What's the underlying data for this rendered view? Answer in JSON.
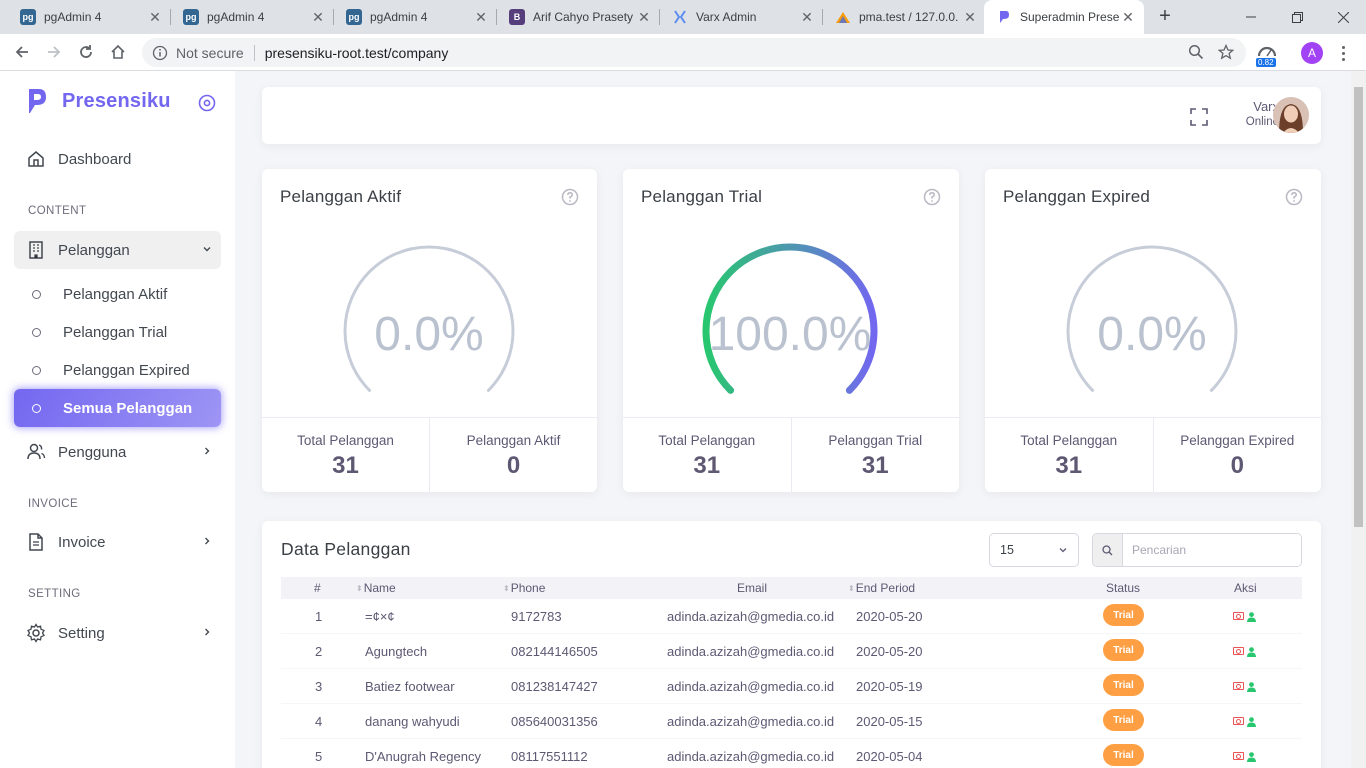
{
  "browser": {
    "tabs": [
      {
        "title": "pgAdmin 4",
        "favicon": "pgadmin-icon"
      },
      {
        "title": "pgAdmin 4",
        "favicon": "pgadmin-icon"
      },
      {
        "title": "pgAdmin 4",
        "favicon": "pgadmin-icon"
      },
      {
        "title": "Arif Cahyo Prasety",
        "favicon": "bootstrap-icon"
      },
      {
        "title": "Varx Admin",
        "favicon": "varx-icon"
      },
      {
        "title": "pma.test / 127.0.0.",
        "favicon": "phpmyadmin-icon"
      },
      {
        "title": "Superadmin Prese",
        "favicon": "presensiku-icon"
      }
    ],
    "active_tab": 6,
    "security_label": "Not secure",
    "url": "presensiku-root.test/company",
    "extension_badge": "0.82",
    "profile_initial": "A"
  },
  "sidebar": {
    "brand": "Presensiku",
    "dashboard": "Dashboard",
    "sections": {
      "content": "CONTENT",
      "invoice": "INVOICE",
      "setting": "SETTING"
    },
    "pelanggan": "Pelanggan",
    "sub_items": [
      "Pelanggan Aktif",
      "Pelanggan Trial",
      "Pelanggan Expired",
      "Semua Pelanggan"
    ],
    "pengguna": "Pengguna",
    "invoice": "Invoice",
    "setting": "Setting"
  },
  "header": {
    "user_name": "Varx",
    "user_status": "Online"
  },
  "stats": [
    {
      "title": "Pelanggan Aktif",
      "percent_label": "0.0%",
      "percent": 0,
      "left_label": "Total Pelanggan",
      "left_value": "31",
      "right_label": "Pelanggan Aktif",
      "right_value": "0"
    },
    {
      "title": "Pelanggan Trial",
      "percent_label": "100.0%",
      "percent": 100,
      "left_label": "Total Pelanggan",
      "left_value": "31",
      "right_label": "Pelanggan Trial",
      "right_value": "31"
    },
    {
      "title": "Pelanggan Expired",
      "percent_label": "0.0%",
      "percent": 0,
      "left_label": "Total Pelanggan",
      "left_value": "31",
      "right_label": "Pelanggan Expired",
      "right_value": "0"
    }
  ],
  "colors": {
    "accent": "#7367f0",
    "gauge_start": "#28c76f",
    "gauge_end": "#7367f0",
    "trial_badge": "#ff9f43",
    "delete": "#ea5455",
    "user": "#28c76f"
  },
  "table": {
    "title": "Data Pelanggan",
    "per_page": "15",
    "search_placeholder": "Pencarian",
    "columns": [
      "#",
      "Name",
      "Phone",
      "Email",
      "End Period",
      "Status",
      "Aksi"
    ],
    "rows": [
      {
        "no": "1",
        "name": "=¢×¢",
        "phone": "9172783",
        "email": "adinda.azizah@gmedia.co.id",
        "end": "2020-05-20",
        "status": "Trial"
      },
      {
        "no": "2",
        "name": "Agungtech",
        "phone": "082144146505",
        "email": "adinda.azizah@gmedia.co.id",
        "end": "2020-05-20",
        "status": "Trial"
      },
      {
        "no": "3",
        "name": "Batiez footwear",
        "phone": "081238147427",
        "email": "adinda.azizah@gmedia.co.id",
        "end": "2020-05-19",
        "status": "Trial"
      },
      {
        "no": "4",
        "name": "danang wahyudi",
        "phone": "085640031356",
        "email": "adinda.azizah@gmedia.co.id",
        "end": "2020-05-15",
        "status": "Trial"
      },
      {
        "no": "5",
        "name": "D'Anugrah Regency",
        "phone": "08117551112",
        "email": "adinda.azizah@gmedia.co.id",
        "end": "2020-05-04",
        "status": "Trial"
      }
    ]
  }
}
